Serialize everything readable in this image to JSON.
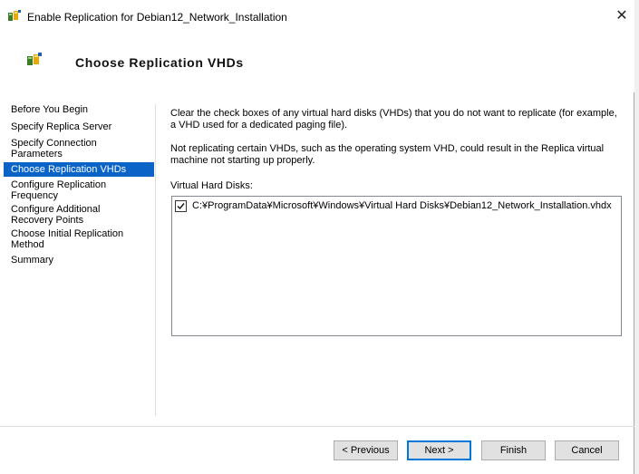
{
  "window": {
    "title": "Enable Replication for Debian12_Network_Installation",
    "close_glyph": "✕"
  },
  "header": {
    "title": "Choose Replication VHDs",
    "icon": "replication-icon"
  },
  "nav": {
    "items": [
      {
        "label": "Before You Begin"
      },
      {
        "label": "Specify Replica Server"
      },
      {
        "label_line1": "Specify Connection",
        "label_line2": "Parameters"
      },
      {
        "label": "Choose Replication VHDs",
        "selected": true
      },
      {
        "label_line1": "Configure Replication",
        "label_line2": "Frequency"
      },
      {
        "label_line1": "Configure Additional",
        "label_line2": "Recovery Points"
      },
      {
        "label_line1": "Choose Initial Replication",
        "label_line2": "Method"
      },
      {
        "label": "Summary"
      }
    ]
  },
  "content": {
    "p1_line1": "Clear the check boxes of any virtual hard disks (VHDs) that you do not want to replicate (for example,",
    "p1_line2": "a VHD used for a dedicated paging file).",
    "p2_line1": "Not replicating certain VHDs, such as the operating system VHD, could result in the Replica virtual",
    "p2_line2": "machine not starting up properly.",
    "vhd_label": "Virtual Hard Disks:",
    "vhds": [
      {
        "path": "C:¥ProgramData¥Microsoft¥Windows¥Virtual Hard Disks¥Debian12_Network_Installation.vhdx",
        "checked": true
      }
    ]
  },
  "buttons": {
    "previous": "< Previous",
    "next": "Next >",
    "finish": "Finish",
    "cancel": "Cancel"
  },
  "colors": {
    "selection": "#0a64c8",
    "default_button_border": "#0078d7"
  }
}
